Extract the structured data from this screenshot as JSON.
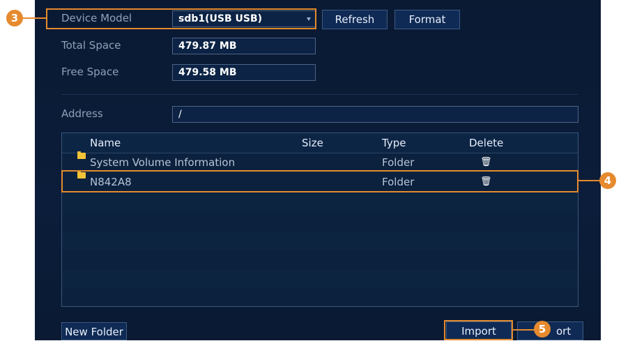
{
  "device": {
    "model_label": "Device Model",
    "model_value": "sdb1(USB USB)",
    "total_label": "Total Space",
    "total_value": "479.87 MB",
    "free_label": "Free Space",
    "free_value": "479.58 MB",
    "refresh_label": "Refresh",
    "format_label": "Format"
  },
  "address": {
    "label": "Address",
    "value": "/"
  },
  "table": {
    "columns": [
      "Name",
      "Size",
      "Type",
      "Delete"
    ],
    "rows": [
      {
        "name": "System Volume Information",
        "size": "",
        "type": "Folder",
        "delete_icon": "trash-icon"
      },
      {
        "name": "N842A8",
        "size": "",
        "type": "Folder",
        "delete_icon": "trash-icon"
      }
    ]
  },
  "buttons": {
    "new_folder": "New Folder",
    "import": "Import",
    "export_partial": "ort"
  },
  "callouts": [
    "3",
    "4",
    "5"
  ],
  "colors": {
    "callout": "#e58a2e",
    "panel": "#0b1d3a",
    "folder": "#f2c337"
  }
}
